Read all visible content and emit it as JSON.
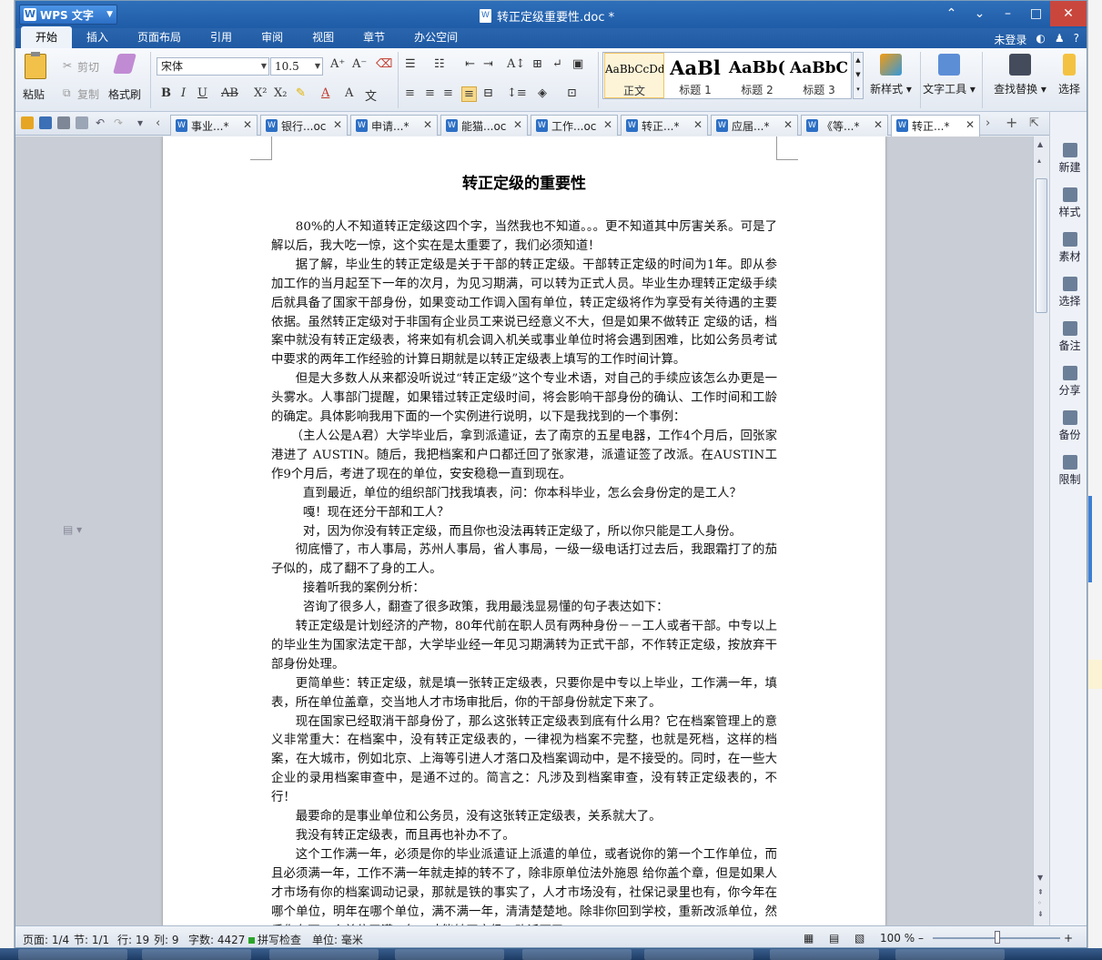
{
  "window": {
    "app_button": "WPS 文字",
    "doc_title": "转正定级重要性.doc *"
  },
  "menu": {
    "tabs": [
      "开始",
      "插入",
      "页面布局",
      "引用",
      "审阅",
      "视图",
      "章节",
      "办公空间"
    ],
    "login": "未登录"
  },
  "ribbon": {
    "paste": "粘贴",
    "cut": "剪切",
    "copy": "复制",
    "format_painter": "格式刷",
    "font_name": "宋体",
    "font_size": "10.5",
    "styles": [
      {
        "preview": "AaBbCcDd",
        "name": "正文"
      },
      {
        "preview": "AaBl",
        "name": "标题 1"
      },
      {
        "preview": "AaBb(",
        "name": "标题 2"
      },
      {
        "preview": "AaBbC",
        "name": "标题 3"
      }
    ],
    "new_style": "新样式",
    "text_tools": "文字工具",
    "find_replace": "查找替换",
    "select": "选择"
  },
  "tabs": [
    {
      "label": "事业...*",
      "active": false
    },
    {
      "label": "银行...oc",
      "active": false
    },
    {
      "label": "申请...*",
      "active": false
    },
    {
      "label": "能猫...oc",
      "active": false
    },
    {
      "label": "工作...oc",
      "active": false
    },
    {
      "label": "转正...*",
      "active": false
    },
    {
      "label": "应届...*",
      "active": false
    },
    {
      "label": "《等...*",
      "active": false
    },
    {
      "label": "转正...*",
      "active": true
    }
  ],
  "document": {
    "title": "转正定级的重要性",
    "paragraphs": [
      {
        "cls": "",
        "text": "80%的人不知道转正定级这四个字，当然我也不知道。。。更不知道其中厉害关系。可是了解以后，我大吃一惊，这个实在是太重要了，我们必须知道！"
      },
      {
        "cls": "",
        "text": "据了解，毕业生的转正定级是关于干部的转正定级。干部转正定级的时间为1年。即从参加工作的当月起至下一年的次月，为见习期满，可以转为正式人员。毕业生办理转正定级手续后就具备了国家干部身份，如果变动工作调入国有单位，转正定级将作为享受有关待遇的主要依据。虽然转正定级对于非国有企业员工来说已经意义不大，但是如果不做转正 定级的话，档案中就没有转正定级表，将来如有机会调入机关或事业单位时将会遇到困难，比如公务员考试中要求的两年工作经验的计算日期就是以转正定级表上填写的工作时间计算。"
      },
      {
        "cls": "",
        "text": "但是大多数人从来都没听说过“转正定级”这个专业术语，对自己的手续应该怎么办更是一头雾水。人事部门提醒，如果错过转正定级时间，将会影响干部身份的确认、工作时间和工龄的确定。具体影响我用下面的一个实例进行说明，以下是我找到的一个事例："
      },
      {
        "cls": "ind2",
        "text": "（主人公是A君）大学毕业后，拿到派遣证，去了南京的五星电器，工作4个月后，回张家港进了 AUSTIN。随后，我把档案和户口都迁回了张家港，派遣证签了改派。在AUSTIN工作9个月后，考进了现在的单位，安安稳稳一直到现在。"
      },
      {
        "cls": "ind",
        "text": "直到最近，单位的组织部门找我填表，问：你本科毕业，怎么会身份定的是工人？"
      },
      {
        "cls": "ind",
        "text": "嘎！现在还分干部和工人？"
      },
      {
        "cls": "ind",
        "text": "对，因为你没有转正定级，而且你也没法再转正定级了，所以你只能是工人身份。"
      },
      {
        "cls": "",
        "text": "  彻底懵了，市人事局，苏州人事局，省人事局，一级一级电话打过去后，我跟霜打了的茄子似的，成了翻不了身的工人。"
      },
      {
        "cls": "ind",
        "text": "接着听我的案例分析："
      },
      {
        "cls": "ind",
        "text": "咨询了很多人，翻查了很多政策，我用最浅显易懂的句子表达如下："
      },
      {
        "cls": "",
        "text": "  转正定级是计划经济的产物，80年代前在职人员有两种身份－－工人或者干部。中专以上的毕业生为国家法定干部，大学毕业经一年见习期满转为正式干部，不作转正定级，按放弃干部身份处理。"
      },
      {
        "cls": "",
        "text": "  更简单些：转正定级，就是填一张转正定级表，只要你是中专以上毕业，工作满一年，填表，所在单位盖章，交当地人才市场审批后，你的干部身份就定下来了。"
      },
      {
        "cls": "",
        "text": "  现在国家已经取消干部身份了，那么这张转正定级表到底有什么用？它在档案管理上的意义非常重大：在档案中，没有转正定级表的，一律视为档案不完整，也就是死档，这样的档案，在大城市，例如北京、上海等引进人才落口及档案调动中，是不接受的。同时，在一些大企业的录用档案审查中，是通不过的。简言之：凡涉及到档案审查，没有转正定级表的，不行！"
      },
      {
        "cls": "",
        "text": "最要命的是事业单位和公务员，没有这张转正定级表，关系就大了。"
      },
      {
        "cls": "",
        "text": "我没有转正定级表，而且再也补办不了。"
      },
      {
        "cls": "",
        "text": "这个工作满一年，必须是你的毕业派遣证上派遣的单位，或者说你的第一个工作单位，而且必须满一年，工作不满一年就走掉的转不了，除非原单位法外施恩 给你盖个章，但是如果人才市场有你的档案调动记录，那就是铁的事实了，人才市场没有，社保记录里也有，你今年在哪个单位，明年在哪个单位，满不满一年，清清楚楚地。除非你回到学校，重新改派单位，然后你在下一个单位干满一年，才能转正定级。改派不了。"
      }
    ]
  },
  "side_panel": [
    "新建",
    "样式",
    "素材",
    "选择",
    "备注",
    "分享",
    "备份",
    "限制"
  ],
  "status": {
    "page": "页面: 1/4",
    "section": "节: 1/1",
    "row": "行: 19",
    "col": "列: 9",
    "words": "字数: 4427",
    "spell": "拼写检查",
    "unit": "单位: 毫米",
    "zoom": "100 %"
  }
}
